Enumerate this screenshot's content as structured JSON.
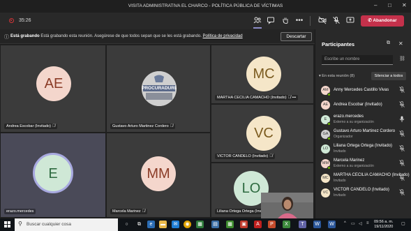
{
  "window": {
    "title": "VISITA ADMINISTRATIVA EL CHARCO - POLÍTICA PÚBLICA DE VÍCTIMAS",
    "minimize": "–",
    "maximize": "□",
    "close": "✕"
  },
  "callbar": {
    "timer": "35:26",
    "leave_label": "Abandonar"
  },
  "banner": {
    "title": "Está grabando",
    "message": "Está grabando esta reunión. Asegúrese de que todos sepan que se les está grabando.",
    "link": "Política de privacidad",
    "dismiss_label": "Descartar"
  },
  "tiles": [
    {
      "initials": "AE",
      "name": "Andrea Escobar (Invitado)",
      "color": "#f4d6cc",
      "text_color": "#8a3b26"
    },
    {
      "initials": "",
      "name": "Gustavo Arturo Martinez Cordero",
      "logo_text": "PROCURADURIA"
    },
    {
      "initials": "MC",
      "name": "MARTHA CECILIA CAMACHO (Invitado)",
      "color": "#f5e6c8",
      "text_color": "#7a5a1e"
    },
    {
      "initials": "VC",
      "name": "VICTOR CANDELO (Invitado)",
      "color": "#f5e6c8",
      "text_color": "#7a5a1e"
    },
    {
      "initials": "E",
      "name": "erazo.mercedes",
      "color": "#cfe8d6",
      "text_color": "#2d6a3f"
    },
    {
      "initials": "MM",
      "name": "Marcela Marinez",
      "color": "#f4d6cc",
      "text_color": "#8a3b26"
    },
    {
      "initials": "LO",
      "name": "Liliana Ortega Ortega (Invitado)",
      "color": "#cfe8d6",
      "text_color": "#2d6a3f"
    }
  ],
  "panel": {
    "title": "Participantes",
    "search_placeholder": "Escribe un nombre",
    "section_label": "En esta reunión (8)",
    "mute_all_label": "Silenciar a todos",
    "participants": [
      {
        "name": "Anny Mercedes Castillo Vivas",
        "role": "",
        "initials": "AM",
        "avatar_color": "#f4d6cc",
        "status": "#6bb700",
        "mic": "muted"
      },
      {
        "name": "Andrea Escobar (Invitado)",
        "role": "",
        "initials": "AE",
        "avatar_color": "#f4d6cc",
        "status": "",
        "mic": "muted"
      },
      {
        "name": "erazo.mercedes",
        "role": "Externo a su organización",
        "initials": "E",
        "avatar_color": "#cfe8d6",
        "status": "#6bb700",
        "mic": "on"
      },
      {
        "name": "Gustavo Arturo Martinez Cordero",
        "role": "Organizador",
        "initials": "GA",
        "avatar_color": "#d0d0d0",
        "status": "#6bb700",
        "mic": "muted"
      },
      {
        "name": "Liliana Ortega Ortega (Invitado)",
        "role": "Invitado",
        "initials": "LO",
        "avatar_color": "#cfe8d6",
        "status": "",
        "mic": "muted"
      },
      {
        "name": "Marcela Marinez",
        "role": "Externo a su organización",
        "initials": "MM",
        "avatar_color": "#f4d6cc",
        "status": "#6bb700",
        "mic": "muted"
      },
      {
        "name": "MARTHA CECILIA CAMACHO (Invitado)",
        "role": "Invitado",
        "initials": "MC",
        "avatar_color": "#f5e6c8",
        "status": "",
        "mic": "muted"
      },
      {
        "name": "VICTOR CANDELO (Invitado)",
        "role": "Invitado",
        "initials": "VC",
        "avatar_color": "#f5e6c8",
        "status": "",
        "mic": "muted"
      }
    ]
  },
  "taskbar": {
    "search_placeholder": "Buscar cualquier cosa",
    "time": "09:56 a. m.",
    "date": "19/11/2020"
  }
}
